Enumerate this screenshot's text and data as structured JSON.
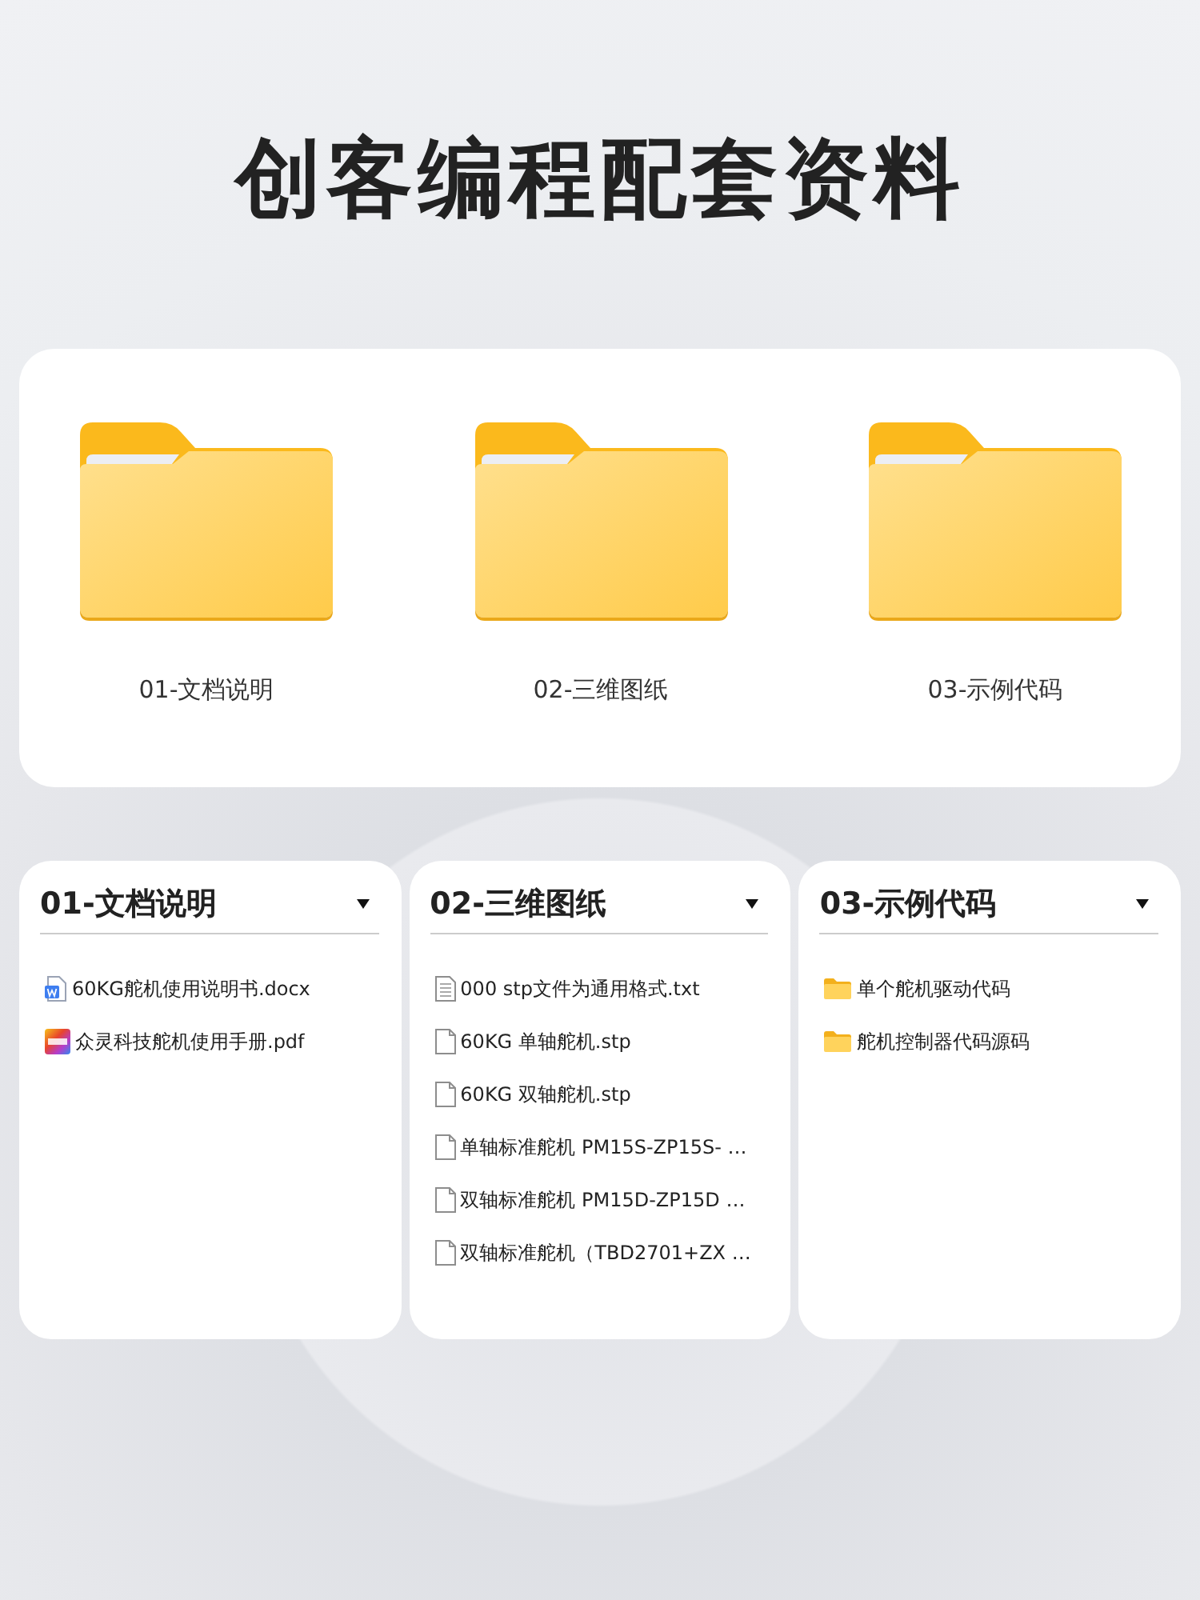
{
  "title": "创客编程配套资料",
  "folders": [
    {
      "label": "01-文档说明"
    },
    {
      "label": "02-三维图纸"
    },
    {
      "label": "03-示例代码"
    }
  ],
  "panels": [
    {
      "title": "01-文档说明",
      "files": [
        {
          "kind": "word",
          "name": "60KG舵机使用说明书.docx"
        },
        {
          "kind": "pdf",
          "name": "众灵科技舵机使用手册.pdf"
        }
      ]
    },
    {
      "title": "02-三维图纸",
      "files": [
        {
          "kind": "text",
          "name": "000 stp文件为通用格式.txt"
        },
        {
          "kind": "blank",
          "name": "60KG 单轴舵机.stp"
        },
        {
          "kind": "blank",
          "name": "60KG 双轴舵机.stp"
        },
        {
          "kind": "blank",
          "name": "单轴标准舵机 PM15S-ZP15S- …"
        },
        {
          "kind": "blank",
          "name": "双轴标准舵机 PM15D-ZP15D …"
        },
        {
          "kind": "blank",
          "name": "双轴标准舵机（TBD2701+ZX …"
        }
      ]
    },
    {
      "title": "03-示例代码",
      "files": [
        {
          "kind": "folder",
          "name": "单个舵机驱动代码"
        },
        {
          "kind": "folder",
          "name": "舵机控制器代码源码"
        }
      ]
    }
  ]
}
